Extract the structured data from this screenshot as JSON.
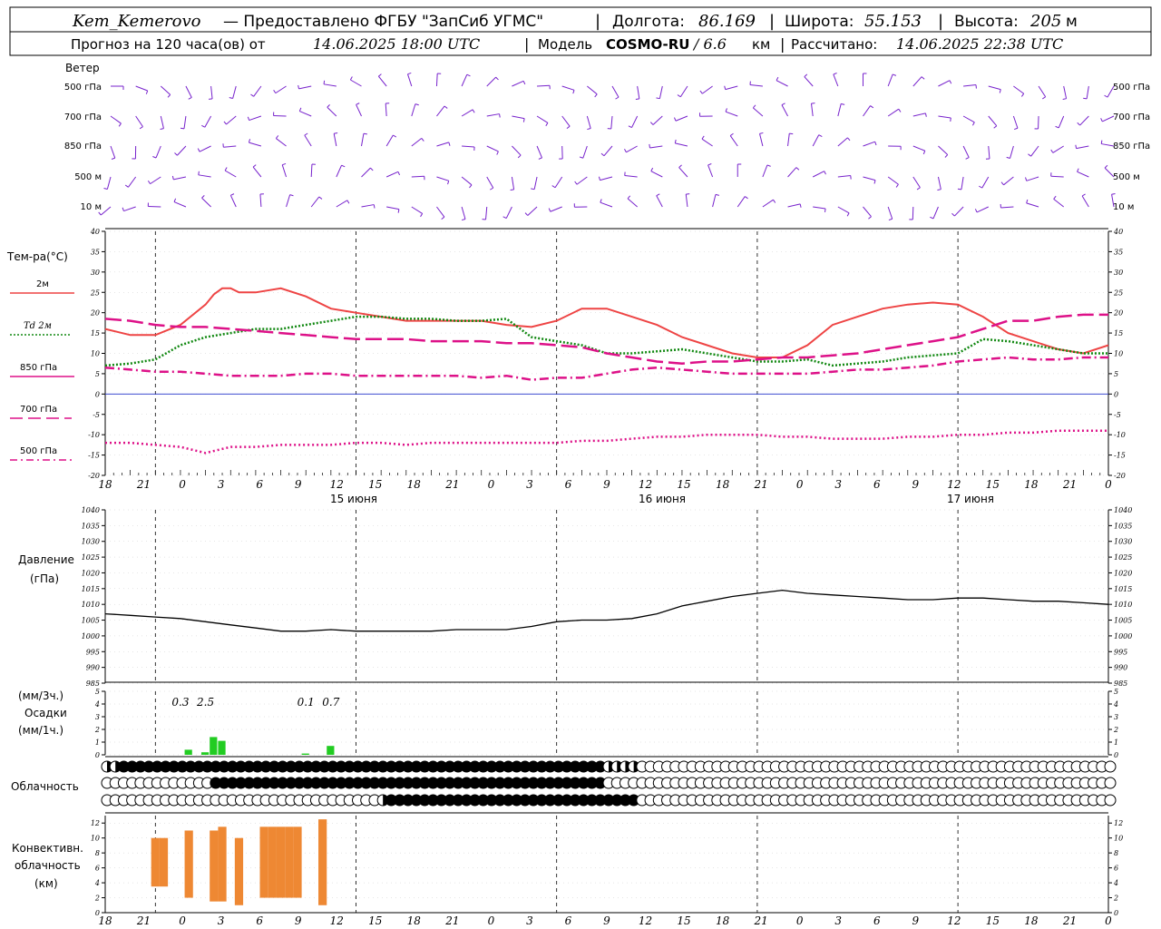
{
  "header": {
    "station": "Kem_Kemerovo",
    "provider": "— Предоставлено ФГБУ \"ЗапСиб УГМС\"",
    "lon_label": "Долгота:",
    "lon": "86.169",
    "lat_label": "Широта:",
    "lat": "55.153",
    "alt_label": "Высота:",
    "alt": "205",
    "alt_unit": "м",
    "forecast_label": "Прогноз на 120 часа(ов) от",
    "forecast_time": "14.06.2025 18:00 UTC",
    "model_label": "Модель",
    "model": "COSMO-RU",
    "resolution": "/ 6.6",
    "resolution_unit": "км",
    "calc_label": "Рассчитано:",
    "calc_time": "14.06.2025 22:38 UTC"
  },
  "time_axis": {
    "hour_ticks": [
      "18",
      "21",
      "0",
      "3",
      "6",
      "9",
      "12",
      "15",
      "18",
      "21",
      "0",
      "3",
      "6",
      "9",
      "12",
      "15",
      "18",
      "21",
      "0",
      "3",
      "6",
      "9",
      "12",
      "15",
      "18",
      "21",
      "0"
    ],
    "day_labels": [
      "15 июня",
      "16 июня",
      "17 июня"
    ]
  },
  "wind": {
    "title": "Ветер",
    "levels": [
      "500 гПа",
      "700 гПа",
      "850 гПа",
      "500 м",
      "10  м"
    ]
  },
  "temperature_panel": {
    "title": "Тем-ра(°С)",
    "legend": [
      {
        "label": "2м",
        "color": "#ee4444",
        "style": "solid"
      },
      {
        "label": "Td  2м",
        "color": "#118811",
        "style": "dotted"
      },
      {
        "label": "850 гПа",
        "color": "#dd1188",
        "style": "dash"
      },
      {
        "label": "700 гПа",
        "color": "#dd1188",
        "style": "dashdot"
      },
      {
        "label": "500 гПа",
        "color": "#dd1188",
        "style": "dots"
      }
    ],
    "yticks": [
      "40",
      "35",
      "30",
      "25",
      "20",
      "15",
      "10",
      "5",
      "0",
      "-5",
      "-10",
      "-15",
      "-20"
    ]
  },
  "pressure_panel": {
    "title": "Давление",
    "unit": "(гПа)",
    "yticks": [
      "1040",
      "1035",
      "1030",
      "1025",
      "1020",
      "1015",
      "1010",
      "1005",
      "1000",
      "995",
      "990",
      "985"
    ]
  },
  "precip_panel": {
    "unit3": "(мм/3ч.)",
    "title": "Осадки",
    "unit1": "(мм/1ч.)",
    "yticks": [
      "5",
      "4",
      "3",
      "2",
      "1",
      "0"
    ],
    "totals": [
      {
        "value": "0.3",
        "hour": 9
      },
      {
        "value": "2.5",
        "hour": 12
      },
      {
        "value": "0.1",
        "hour": 24
      },
      {
        "value": "0.7",
        "hour": 27
      }
    ]
  },
  "cloud_panel": {
    "title": "Облачность"
  },
  "convective_panel": {
    "title1": "Конвективн.",
    "title2": "облачность",
    "unit": "(км)",
    "yticks": [
      "12",
      "10",
      "8",
      "6",
      "4",
      "2",
      "0"
    ]
  },
  "chart_data": {
    "type": "line",
    "x_unit": "hours from 14.06.2025 18:00 UTC",
    "series": [
      {
        "name": "2м",
        "color": "#ee4444",
        "x": [
          0,
          3,
          6,
          9,
          12,
          13,
          14,
          15,
          16,
          18,
          21,
          24,
          27,
          30,
          33,
          36,
          39,
          42,
          45,
          48,
          51,
          54,
          57,
          60,
          63,
          66,
          69,
          72,
          75,
          78,
          81,
          84,
          87,
          90,
          93,
          96,
          99,
          102,
          105,
          108,
          111,
          114,
          117,
          120
        ],
        "y": [
          16,
          14.5,
          14.5,
          17,
          22,
          24.5,
          26,
          26,
          25,
          25,
          26,
          24,
          21,
          20,
          19,
          18,
          18,
          18,
          18,
          17,
          16.5,
          18,
          21,
          21,
          19,
          17,
          14,
          12,
          10,
          9,
          9,
          12,
          17,
          19,
          21,
          22,
          22.5,
          22,
          19,
          15,
          13,
          11,
          10,
          12
        ]
      },
      {
        "name": "Td  2м",
        "color": "#118811",
        "x": [
          0,
          3,
          6,
          9,
          12,
          15,
          18,
          21,
          24,
          27,
          30,
          33,
          36,
          39,
          42,
          45,
          48,
          51,
          54,
          57,
          60,
          63,
          66,
          69,
          72,
          75,
          78,
          81,
          84,
          87,
          90,
          93,
          96,
          99,
          102,
          105,
          108,
          111,
          114,
          117,
          120
        ],
        "y": [
          7,
          7.5,
          8.5,
          12,
          14,
          15,
          16,
          16,
          17,
          18,
          19,
          19,
          18.5,
          18.5,
          18,
          18,
          18.5,
          14,
          13,
          12,
          10,
          10,
          10.5,
          11,
          10,
          9,
          8,
          8,
          8.5,
          7,
          7.5,
          8,
          9,
          9.5,
          10,
          13.5,
          13,
          12,
          11,
          10,
          10
        ]
      },
      {
        "name": "850 гПа",
        "color": "#dd1188",
        "x": [
          0,
          3,
          6,
          9,
          12,
          15,
          18,
          21,
          24,
          27,
          30,
          33,
          36,
          39,
          42,
          45,
          48,
          51,
          54,
          57,
          60,
          63,
          66,
          69,
          72,
          75,
          78,
          81,
          84,
          87,
          90,
          93,
          96,
          99,
          102,
          105,
          108,
          111,
          114,
          117,
          120
        ],
        "y": [
          18.5,
          18,
          17,
          16.5,
          16.5,
          16,
          15.5,
          15,
          14.5,
          14,
          13.5,
          13.5,
          13.5,
          13,
          13,
          13,
          12.5,
          12.5,
          12,
          11.5,
          10,
          9,
          8,
          7.5,
          8,
          8,
          8.5,
          9,
          9,
          9.5,
          10,
          11,
          12,
          13,
          14,
          16,
          18,
          18,
          19,
          19.5,
          19.5
        ]
      },
      {
        "name": "700 гПа",
        "color": "#dd1188",
        "x": [
          0,
          3,
          6,
          9,
          12,
          15,
          18,
          21,
          24,
          27,
          30,
          33,
          36,
          39,
          42,
          45,
          48,
          51,
          54,
          57,
          60,
          63,
          66,
          69,
          72,
          75,
          78,
          81,
          84,
          87,
          90,
          93,
          96,
          99,
          102,
          105,
          108,
          111,
          114,
          117,
          120
        ],
        "y": [
          6.5,
          6,
          5.5,
          5.5,
          5,
          4.5,
          4.5,
          4.5,
          5,
          5,
          4.5,
          4.5,
          4.5,
          4.5,
          4.5,
          4,
          4.5,
          3.5,
          4,
          4,
          5,
          6,
          6.5,
          6,
          5.5,
          5,
          5,
          5,
          5,
          5.5,
          6,
          6,
          6.5,
          7,
          8,
          8.5,
          9,
          8.5,
          8.5,
          9,
          9
        ]
      },
      {
        "name": "500 гПа",
        "color": "#dd1188",
        "x": [
          0,
          3,
          6,
          9,
          12,
          15,
          18,
          21,
          24,
          27,
          30,
          33,
          36,
          39,
          42,
          45,
          48,
          51,
          54,
          57,
          60,
          63,
          66,
          69,
          72,
          75,
          78,
          81,
          84,
          87,
          90,
          93,
          96,
          99,
          102,
          105,
          108,
          111,
          114,
          117,
          120
        ],
        "y": [
          -12,
          -12,
          -12.5,
          -13,
          -14.5,
          -13,
          -13,
          -12.5,
          -12.5,
          -12.5,
          -12,
          -12,
          -12.5,
          -12,
          -12,
          -12,
          -12,
          -12,
          -12,
          -11.5,
          -11.5,
          -11,
          -10.5,
          -10.5,
          -10,
          -10,
          -10,
          -10.5,
          -10.5,
          -11,
          -11,
          -11,
          -10.5,
          -10.5,
          -10,
          -10,
          -9.5,
          -9.5,
          -9,
          -9,
          -9
        ]
      },
      {
        "name": "Давление",
        "color": "#000000",
        "x": [
          0,
          3,
          6,
          9,
          12,
          15,
          18,
          21,
          24,
          27,
          30,
          33,
          36,
          39,
          42,
          45,
          48,
          51,
          54,
          57,
          60,
          63,
          66,
          69,
          72,
          75,
          78,
          81,
          84,
          87,
          90,
          93,
          96,
          99,
          102,
          105,
          108,
          111,
          114,
          117,
          120
        ],
        "y": [
          1007,
          1006.5,
          1006,
          1005.5,
          1004.5,
          1003.5,
          1002.5,
          1001.5,
          1001.5,
          1002,
          1001.5,
          1001.5,
          1001.5,
          1001.5,
          1002,
          1002,
          1002,
          1003,
          1004.5,
          1005,
          1005,
          1005.5,
          1007,
          1009.5,
          1011,
          1012.5,
          1013.5,
          1014.5,
          1013.5,
          1013,
          1012.5,
          1012,
          1011.5,
          1011.5,
          1012,
          1012,
          1011.5,
          1011,
          1011,
          1010.5,
          1010
        ]
      },
      {
        "name": "Осадки",
        "color": "#22cc22",
        "x": [
          10,
          11,
          12,
          13,
          14,
          15,
          24,
          27
        ],
        "y": [
          0.4,
          0,
          0.2,
          1.4,
          1.1,
          0,
          0.1,
          0.7
        ]
      },
      {
        "name": "Конвективн. облачность",
        "color": "#ee8833",
        "x": [
          6,
          7,
          9,
          10,
          12,
          13,
          14,
          16,
          19,
          20,
          21,
          22,
          23,
          25,
          26,
          27
        ],
        "top": [
          10,
          10,
          0,
          11,
          0,
          11,
          11.5,
          10,
          11.5,
          11.5,
          11.5,
          11.5,
          11.5,
          0,
          12.5,
          0
        ],
        "base": [
          3.5,
          3.5,
          0,
          2,
          0,
          1.5,
          1.5,
          1,
          2,
          2,
          2,
          2,
          2,
          0,
          1,
          0
        ]
      }
    ],
    "ylim_temperature": [
      -20,
      40
    ],
    "ylim_pressure": [
      985,
      1040
    ],
    "ylim_precip": [
      0,
      5
    ],
    "ylim_convective": [
      0,
      13
    ]
  }
}
